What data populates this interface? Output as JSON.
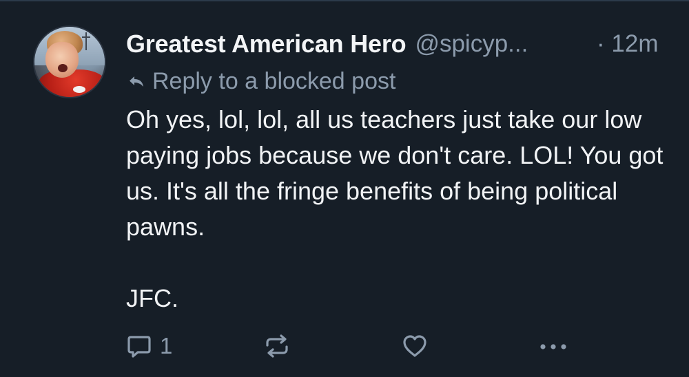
{
  "post": {
    "author": {
      "display_name": "Greatest American Hero",
      "handle": "@spicyp..."
    },
    "separator": "·",
    "time_ago": "12m",
    "reply_context": "Reply to a blocked post",
    "text_paragraphs": [
      "Oh yes, lol, lol, all us teachers just take our low paying jobs because we don't care. LOL! You got us. It's all the fringe benefits of being political pawns.",
      "JFC."
    ],
    "actions": {
      "reply_count": "1"
    }
  },
  "icons": {
    "reply_context": "reply-arrow-icon",
    "reply": "comment-bubble-icon",
    "repost": "repost-arrows-icon",
    "like": "heart-icon",
    "more": "ellipsis-icon"
  },
  "colors": {
    "background": "#161e27",
    "primary_text": "#f1f3f5",
    "secondary_text": "#8c9bac",
    "divider": "#2c3a4a"
  }
}
